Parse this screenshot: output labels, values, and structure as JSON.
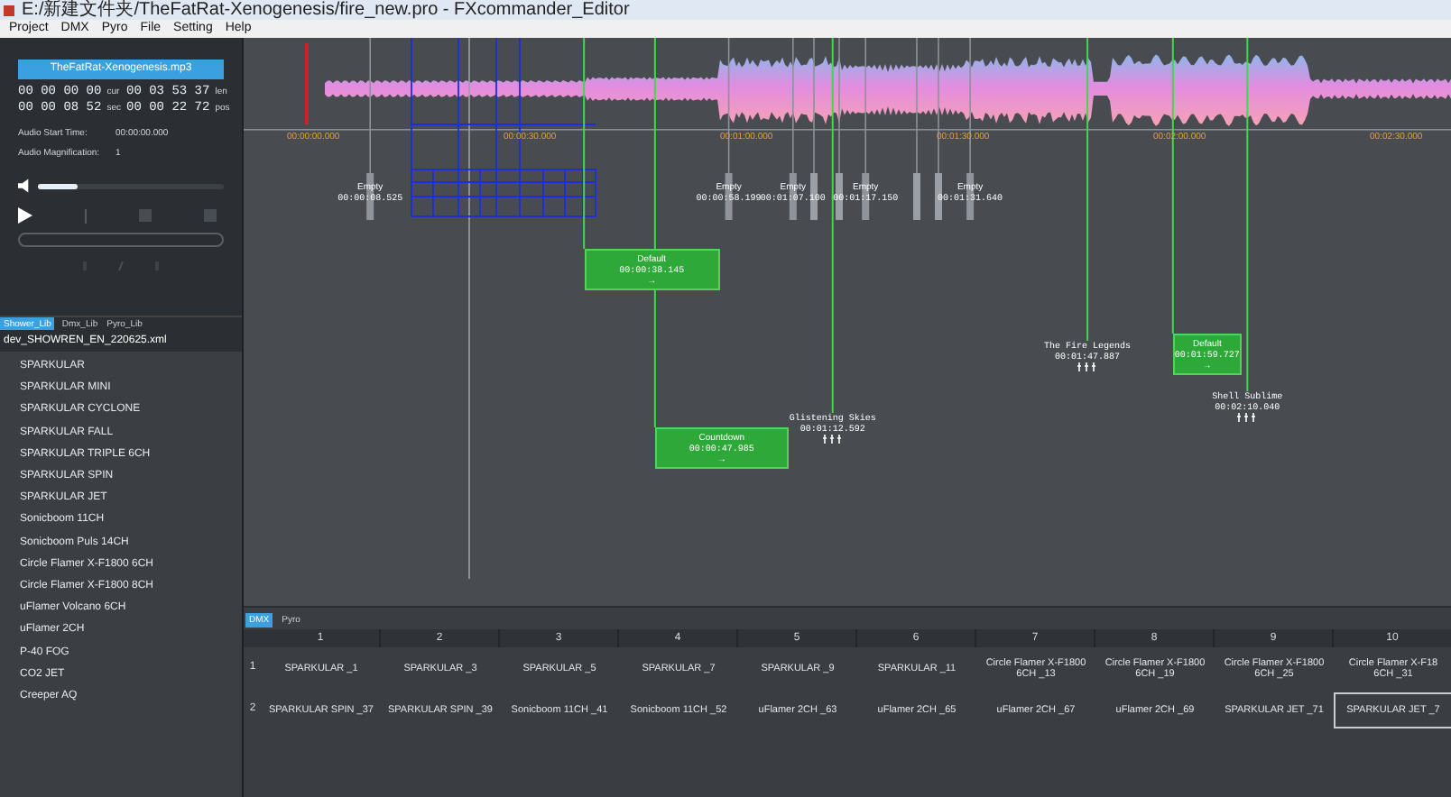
{
  "window": {
    "title": "E:/新建文件夹/TheFatRat-Xenogenesis/fire_new.pro - FXcommander_Editor"
  },
  "menu": [
    "Project",
    "DMX",
    "Pyro",
    "File",
    "Setting",
    "Help"
  ],
  "audio": {
    "file": "TheFatRat-Xenogenesis.mp3",
    "timecodes": [
      {
        "value": "00 00 00 00",
        "unit": "cur"
      },
      {
        "value": "00 03 53 37",
        "unit": "len"
      },
      {
        "value": "00 00 08 52",
        "unit": "sec"
      },
      {
        "value": "00 00 22 72",
        "unit": "pos"
      }
    ],
    "info": [
      {
        "label": "Audio Start Time:",
        "value": "00:00:00.000"
      },
      {
        "label": "Audio Magnification:",
        "value": "1"
      }
    ],
    "volume": {
      "level": 0.22
    }
  },
  "library_tabs": [
    {
      "label": "Shower_Lib",
      "selected": true
    },
    {
      "label": "Dmx_Lib",
      "selected": false
    },
    {
      "label": "Pyro_Lib",
      "selected": false
    }
  ],
  "library_file": "dev_SHOWREN_EN_220625.xml",
  "library_items": [
    "SPARKULAR",
    "SPARKULAR MINI",
    "SPARKULAR CYCLONE",
    "SPARKULAR FALL",
    "SPARKULAR TRIPLE 6CH",
    "SPARKULAR SPIN",
    "SPARKULAR JET",
    "Sonicboom 11CH",
    "Sonicboom Puls 14CH",
    "Circle Flamer X-F1800 6CH",
    "Circle Flamer X-F1800 8CH",
    "uFlamer Volcano 6CH",
    "uFlamer 2CH",
    "P-40 FOG",
    "CO2 JET",
    "Creeper AQ"
  ],
  "timeline": {
    "ruler": [
      "00:00:00.000",
      "00:00:30.000",
      "00:01:00.000",
      "00:01:30.000",
      "00:02:00.000",
      "00:02:30.000"
    ],
    "markers": [
      {
        "label": "Empty",
        "time": "00:00:08.525"
      },
      {
        "label": "Empty",
        "time": "00:00:58.199"
      },
      {
        "label": "Empty",
        "time": "00:01:07.100"
      },
      {
        "label": "Empty",
        "time": "00:01:17.150"
      },
      {
        "label": "Empty",
        "time": "00:01:31.640"
      }
    ],
    "cues": [
      {
        "label": "Default",
        "time": "00:00:38.145",
        "arrow": "→"
      },
      {
        "label": "Default",
        "time": "00:01:59.727",
        "arrow": "→"
      },
      {
        "label": "Countdown",
        "time": "00:00:47.985",
        "arrow": "→"
      }
    ],
    "songs": [
      {
        "label": "The Fire Legends",
        "time": "00:01:47.887"
      },
      {
        "label": "Shell Sublime",
        "time": "00:02:10.040"
      },
      {
        "label": "Glistening Skies",
        "time": "00:01:12.592"
      }
    ]
  },
  "grid": {
    "tabs": [
      {
        "label": "DMX",
        "selected": true
      },
      {
        "label": "Pyro",
        "selected": false
      }
    ],
    "columns": [
      "1",
      "2",
      "3",
      "4",
      "5",
      "6",
      "7",
      "8",
      "9",
      "10"
    ],
    "rows": [
      {
        "number": "1",
        "cells": [
          {
            "text": "SPARKULAR _1",
            "selected": false
          },
          {
            "text": "SPARKULAR _3",
            "selected": false
          },
          {
            "text": "SPARKULAR _5",
            "selected": false
          },
          {
            "text": "SPARKULAR _7",
            "selected": false
          },
          {
            "text": "SPARKULAR _9",
            "selected": false
          },
          {
            "text": "SPARKULAR _11",
            "selected": false
          },
          {
            "text": "Circle Flamer X-F1800 6CH _13",
            "selected": false
          },
          {
            "text": "Circle Flamer X-F1800 6CH _19",
            "selected": false
          },
          {
            "text": "Circle Flamer X-F1800 6CH _25",
            "selected": false
          },
          {
            "text": "Circle Flamer X-F18 6CH _31",
            "selected": false
          }
        ]
      },
      {
        "number": "2",
        "cells": [
          {
            "text": "SPARKULAR SPIN _37",
            "selected": false
          },
          {
            "text": "SPARKULAR SPIN _39",
            "selected": false
          },
          {
            "text": "Sonicboom 11CH _41",
            "selected": false
          },
          {
            "text": "Sonicboom 11CH _52",
            "selected": false
          },
          {
            "text": "uFlamer 2CH _63",
            "selected": false
          },
          {
            "text": "uFlamer 2CH _65",
            "selected": false
          },
          {
            "text": "uFlamer 2CH _67",
            "selected": false
          },
          {
            "text": "uFlamer 2CH _69",
            "selected": false
          },
          {
            "text": "SPARKULAR JET _71",
            "selected": false
          },
          {
            "text": "SPARKULAR JET _7",
            "selected": true
          }
        ]
      }
    ]
  }
}
